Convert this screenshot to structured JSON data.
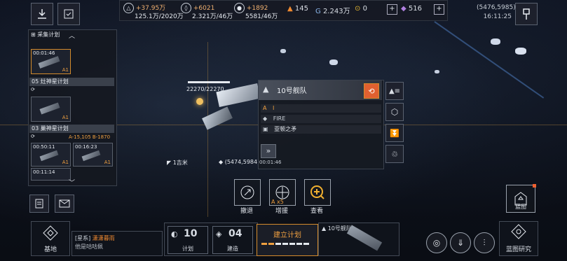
{
  "resources": {
    "r1": {
      "gain": "+37.95万",
      "value": "125.1万/2020万"
    },
    "r2": {
      "gain": "+6021",
      "value": "2.321万/46万"
    },
    "r3": {
      "gain": "+1892",
      "value": "5581/46万"
    },
    "energy": "145",
    "credits": "2.243万",
    "coins": "0",
    "crystals": "516"
  },
  "coords": {
    "position": "(5476,5985)",
    "time": "16:11:25"
  },
  "left_panel": {
    "header": "采集计划",
    "cards": [
      {
        "time": "00:01:46",
        "tag": "A1"
      },
      {
        "title": "05 灶神星计划"
      },
      {
        "tag": "A1"
      },
      {
        "title": "03 巢神星计划",
        "stats": "A-15,105  B-1870"
      },
      {
        "time": "00:50:11",
        "tag": "A1"
      },
      {
        "time": "00:16:23",
        "tag": "A1"
      },
      {
        "time": "00:11:14"
      }
    ]
  },
  "fleet": {
    "hp": "22270/22270",
    "title": "10号舰队",
    "rows": [
      {
        "icon": "A",
        "text": "I"
      },
      {
        "icon": "◆",
        "text": "FIRE"
      },
      {
        "icon": "▣",
        "text": "亚顿之矛"
      }
    ],
    "timer": "00:01:46",
    "distance": "1吉米",
    "target": "(5474,5984)"
  },
  "actions": [
    {
      "label": "撤退",
      "icon": "retreat-icon"
    },
    {
      "label": "增援",
      "icon": "reinforce-icon",
      "badge": "A x5"
    },
    {
      "label": "查看",
      "icon": "view-icon"
    }
  ],
  "blueprint_btn": "蓝图",
  "bottom": {
    "base": "基地",
    "chat_channel": "[星系]",
    "chat_name": "潇潇暮雨",
    "chat_msg": "他是咕咕佩",
    "plan_count": "10",
    "plan_label": "计划",
    "build_count": "04",
    "build_label": "建造",
    "establish_plan": "建立计划",
    "fleet_preview": "10号舰队",
    "research": "蓝图研究"
  }
}
